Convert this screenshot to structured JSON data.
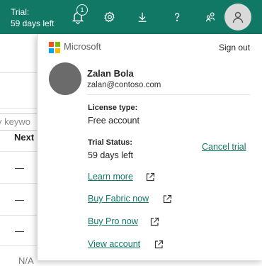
{
  "header": {
    "trial_label": "Trial:",
    "trial_days": "59 days left",
    "notification_count": "1",
    "icons": [
      "bell-icon",
      "gear-icon",
      "download-icon",
      "help-icon",
      "share-icon",
      "person-icon"
    ],
    "bg_color": "#117865"
  },
  "background_page": {
    "search_placeholder": "y keywo",
    "column_header": "Next",
    "dashes": [
      "—",
      "—",
      "—"
    ],
    "last_row": "N/A"
  },
  "account_panel": {
    "brand": "Microsoft",
    "sign_out": "Sign out",
    "user": {
      "name": "Zalan Bola",
      "email": "zalan@contoso.com"
    },
    "license_type_label": "License type:",
    "license_type_value": "Free account",
    "trial_status_label": "Trial Status:",
    "trial_status_value": "59 days left",
    "cancel_trial": "Cancel trial",
    "links": [
      "Learn more",
      "Buy Fabric now",
      "Buy Pro now",
      "View account"
    ],
    "link_color": "#117865"
  }
}
